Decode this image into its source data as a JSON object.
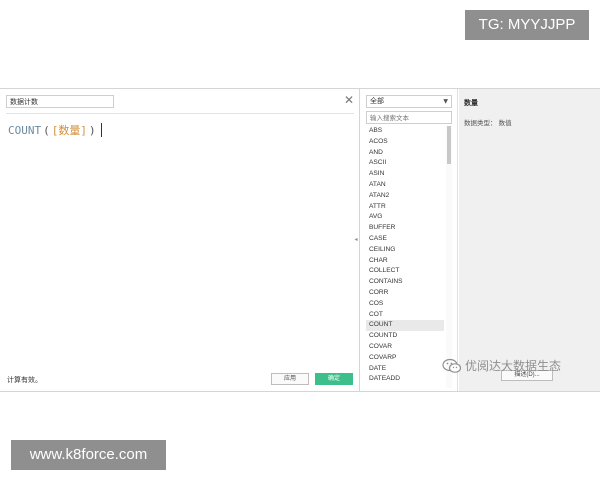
{
  "badges": {
    "top": "TG: MYYJJPP",
    "bottom": "www.k8force.com"
  },
  "editor": {
    "calc_name": "数据计数",
    "formula": {
      "function": "COUNT",
      "open_paren": "(",
      "field": "[数量]",
      "close_paren": ")"
    },
    "status": "计算有效。",
    "apply_label": "应用",
    "ok_label": "确定"
  },
  "function_list": {
    "category": "全部",
    "search_placeholder": "输入搜索文本",
    "items": [
      "ABS",
      "ACOS",
      "AND",
      "ASCII",
      "ASIN",
      "ATAN",
      "ATAN2",
      "ATTR",
      "AVG",
      "BUFFER",
      "CASE",
      "CEILING",
      "CHAR",
      "COLLECT",
      "CONTAINS",
      "CORR",
      "COS",
      "COT",
      "COUNT",
      "COUNTD",
      "COVAR",
      "COVARP",
      "DATE",
      "DATEADD"
    ],
    "selected": "COUNT"
  },
  "description": {
    "title": "数量",
    "type": "数据类型： 数值",
    "describe_label": "描述(D)..."
  },
  "watermark": {
    "text": "优阅达大数据生态"
  },
  "colors": {
    "accent": "#3cbf8a",
    "function_name": "#6c8aa0",
    "field_reference": "#d38f3a",
    "badge": "#8f8f8f"
  }
}
